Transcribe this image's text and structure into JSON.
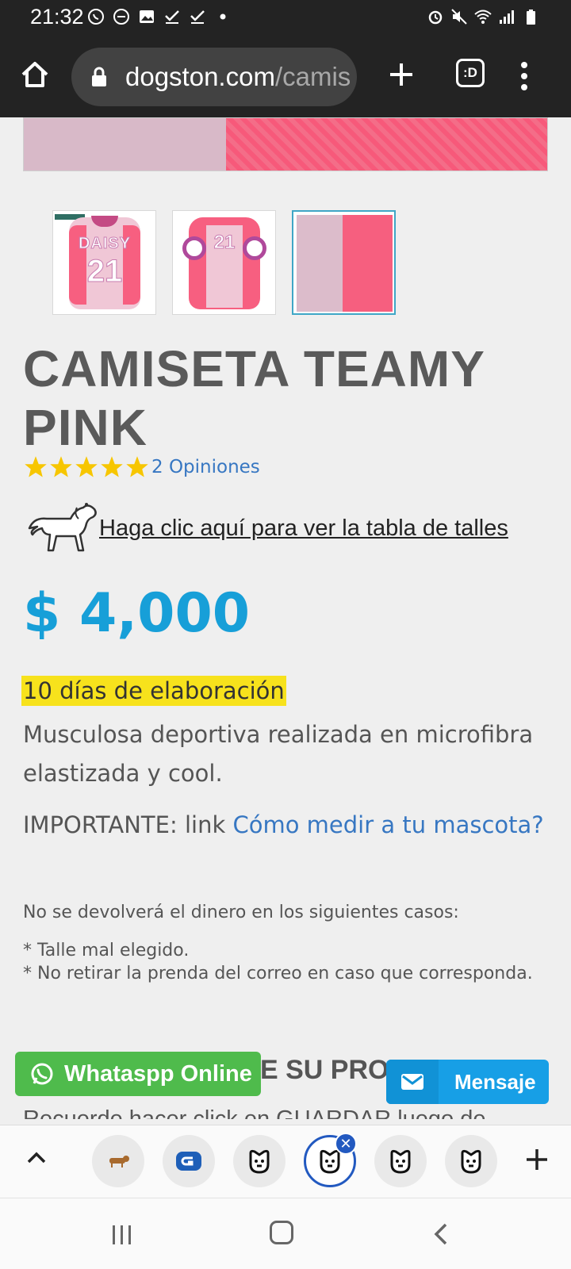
{
  "status_bar": {
    "time": "21:32",
    "left_icons": [
      "whatsapp-icon",
      "do-not-disturb-icon",
      "gallery-icon",
      "check-icon",
      "check-icon",
      "dot-icon"
    ],
    "right_icons": [
      "alarm-icon",
      "mute-icon",
      "wifi-icon",
      "signal-icon",
      "battery-icon"
    ]
  },
  "browser": {
    "url_domain": "dogston.com",
    "url_path": "/camis",
    "tabs_label": ":D"
  },
  "product": {
    "title": "CAMISETA TEAMY PINK",
    "rating_stars": 5,
    "opinions": "2 Opiniones",
    "size_link": "Haga clic aquí para ver la tabla de talles",
    "price": "$ 4,000",
    "elaboration": "10 días de elaboración",
    "description": "Musculosa deportiva realizada en microfibra elastizada y cool.",
    "important_prefix": "IMPORTANTE: link ",
    "important_link": "Cómo medir a tu mascota?",
    "no_refund": "No se devolverá el dinero en los siguientes casos:",
    "case_1": "* Talle mal elegido.",
    "case_2": "* No retirar la prenda del correo en caso que corresponda.",
    "section_head": "E SU PRO",
    "cut_line": "Recuerde hacer click en GUARDAR luego de"
  },
  "thumbnails": [
    {
      "name": "DAISY",
      "number": "21"
    },
    {
      "name": "",
      "number": "21"
    },
    {
      "name": "",
      "number": ""
    }
  ],
  "widgets": {
    "whatsapp": "Whataspp Online",
    "mensaje": "Mensaje"
  },
  "colors": {
    "price": "#179fd8",
    "highlight": "#f7e21c",
    "link": "#3777c2",
    "whatsapp": "#4fbb4c",
    "mensaje": "#179fe6",
    "star": "#f7c600"
  }
}
